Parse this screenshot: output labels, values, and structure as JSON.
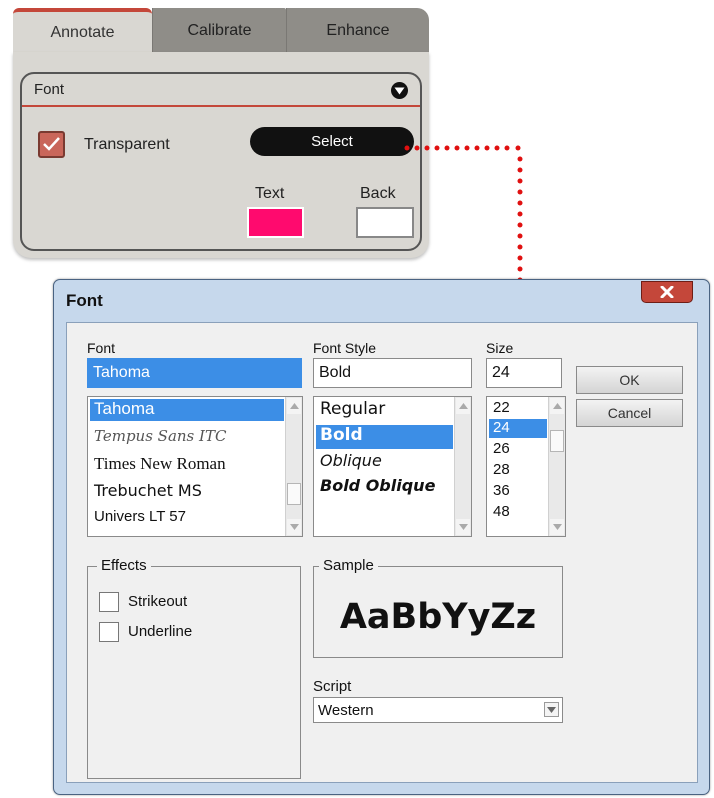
{
  "tabs": [
    {
      "label": "Annotate",
      "active": true
    },
    {
      "label": "Calibrate",
      "active": false
    },
    {
      "label": "Enhance",
      "active": false
    }
  ],
  "panel": {
    "section_title": "Font",
    "transparent_label": "Transparent",
    "transparent_checked": true,
    "select_label": "Select",
    "text_color_label": "Text",
    "back_color_label": "Back",
    "text_color": "#ff0a6e",
    "back_color": "#ffffff"
  },
  "dialog": {
    "title": "Font",
    "font_label": "Font",
    "font_value": "Tahoma",
    "fonts": [
      "Tahoma",
      "Tempus Sans ITC",
      "Times New Roman",
      "Trebuchet MS",
      "Univers LT 57"
    ],
    "selected_font": "Tahoma",
    "style_label": "Font Style",
    "style_value": "Bold",
    "styles": [
      "Regular",
      "Bold",
      "Oblique",
      "Bold Oblique"
    ],
    "selected_style": "Bold",
    "size_label": "Size",
    "size_value": "24",
    "sizes": [
      "22",
      "24",
      "26",
      "28",
      "36",
      "48"
    ],
    "selected_size": "24",
    "ok_label": "OK",
    "cancel_label": "Cancel",
    "effects_label": "Effects",
    "strikeout_label": "Strikeout",
    "underline_label": "Underline",
    "sample_label": "Sample",
    "sample_text": "AaBbYyZz",
    "script_label": "Script",
    "script_value": "Western"
  },
  "colors": {
    "accent": "#c4473a",
    "selection": "#3c8ee6",
    "dialog_frame": "#c6d8ec"
  }
}
